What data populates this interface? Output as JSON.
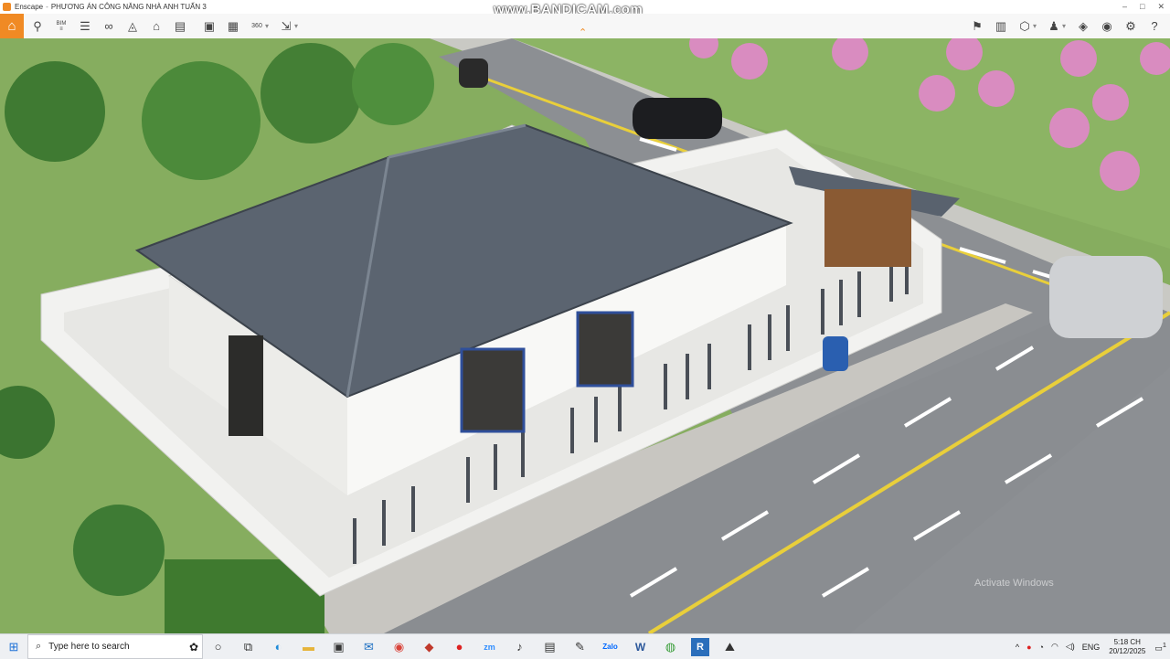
{
  "window": {
    "app_name": "Enscape",
    "project_title": "PHƯƠNG ÁN CÔNG NĂNG NHÀ ANH TUẤN 3",
    "controls": [
      "–",
      "□",
      "✕"
    ]
  },
  "overlay": {
    "watermark": "www.BANDICAM.com",
    "activate_windows": "Activate Windows"
  },
  "toolbar": {
    "left_icons": [
      "home-icon",
      "pin-icon",
      "bim-icon",
      "list-icon",
      "binoculars-icon",
      "compass-icon",
      "building-icon",
      "clapperboard-icon",
      "screenshot-icon",
      "batch-render-icon",
      "panorama-icon",
      "export-icon"
    ],
    "right_icons": [
      "map-icon",
      "asset-library-icon",
      "cube-icon",
      "people-icon",
      "material-icon",
      "visibility-icon",
      "settings-icon",
      "help-icon"
    ],
    "bim_label": "BIM",
    "pano_label": "360",
    "colors": {
      "accent": "#f08a24"
    }
  },
  "taskbar": {
    "search_placeholder": "Type here to search",
    "pinned_icons": [
      "cortana-icon",
      "task-view-icon",
      "edge-icon",
      "file-explorer-icon",
      "store-icon",
      "mail-icon",
      "chrome-icon",
      "sketchup-icon",
      "record-icon",
      "zoom-icon",
      "tiktok-icon",
      "calculator-icon",
      "pen-icon",
      "zalo-icon",
      "word-icon",
      "game-icon",
      "revit-icon",
      "enscape-icon"
    ],
    "zoom_label": "zm",
    "zalo_label": "Zalo",
    "word_label": "W",
    "revit_label": "R",
    "language": "ENG",
    "time": "5:18 CH",
    "date": "20/12/2025",
    "notification_count": "1"
  }
}
